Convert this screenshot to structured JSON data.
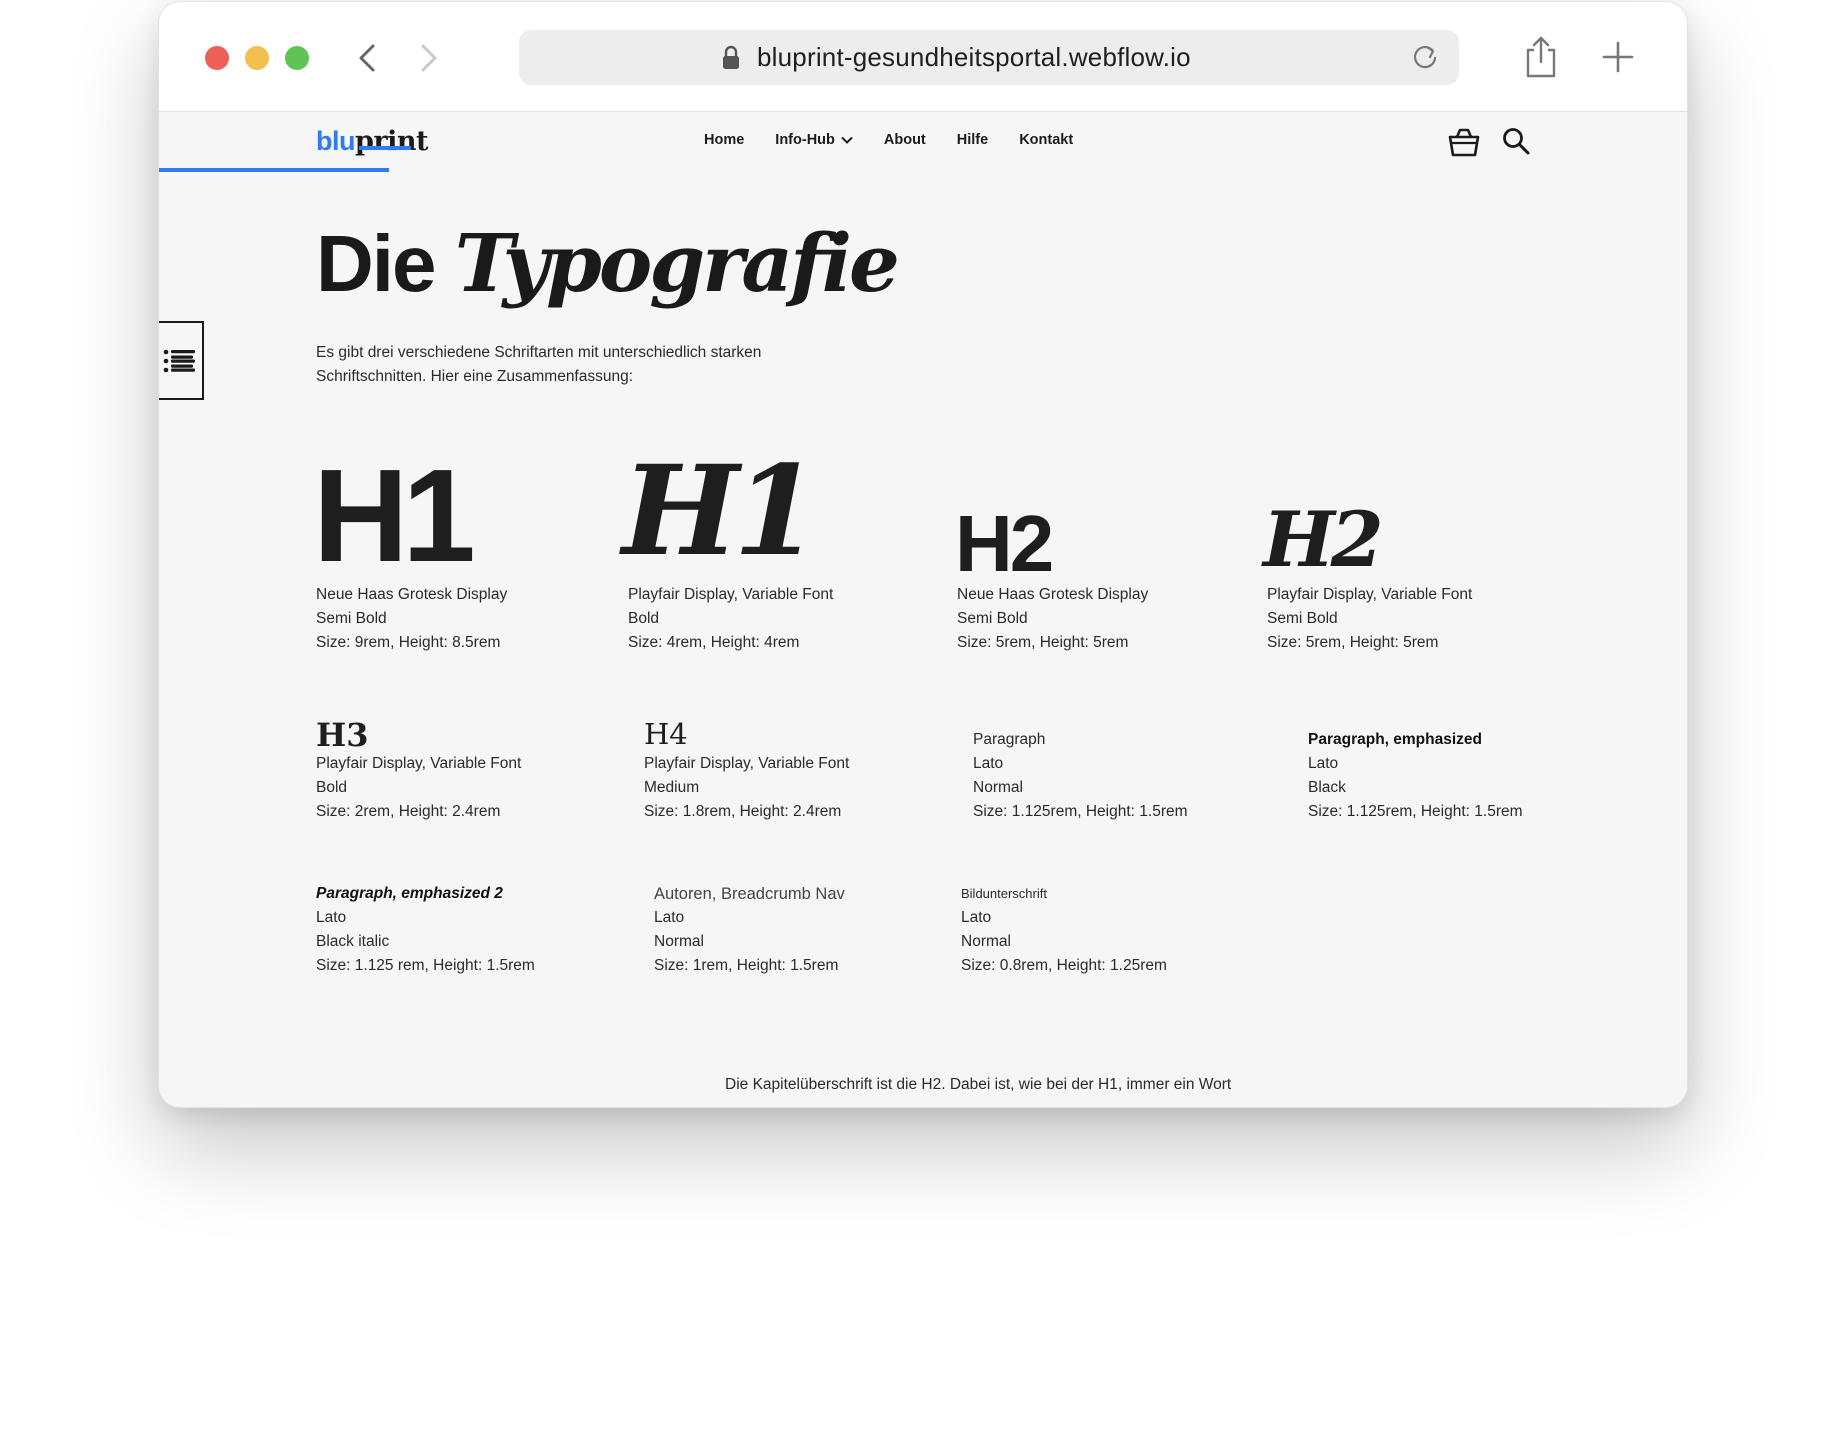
{
  "browser": {
    "url": "bluprint-gesundheitsportal.webflow.io",
    "traffic_lights": {
      "red": "#ed5f57",
      "yellow": "#f4bf4f",
      "green": "#5fc454"
    }
  },
  "site": {
    "logo": {
      "part1": "blu",
      "part2": "print",
      "accent": "#2f7cf0"
    },
    "nav": [
      "Home",
      "Info-Hub",
      "About",
      "Hilfe",
      "Kontakt"
    ]
  },
  "page": {
    "title_plain": "Die ",
    "title_italic": "Typografie",
    "intro": "Es gibt drei verschiedene Schriftarten mit unterschiedlich starken Schriftschnitten. Hier eine Zusammenfassung:"
  },
  "specimens": [
    {
      "sample": "H1",
      "lines": [
        "Neue Haas Grotesk Display",
        "Semi Bold",
        "Size: 9rem, Height: 8.5rem"
      ]
    },
    {
      "sample": "H1",
      "lines": [
        "Playfair Display, Variable Font",
        "Bold",
        "Size: 4rem, Height: 4rem"
      ]
    },
    {
      "sample": "H2",
      "lines": [
        "Neue Haas Grotesk Display",
        "Semi Bold",
        "Size: 5rem, Height: 5rem"
      ]
    },
    {
      "sample": "H2",
      "lines": [
        "Playfair Display, Variable Font",
        "Semi Bold",
        "Size: 5rem, Height: 5rem"
      ]
    },
    {
      "sample": "H3",
      "lines": [
        "Playfair Display, Variable Font",
        "Bold",
        "Size: 2rem, Height: 2.4rem"
      ]
    },
    {
      "sample": "H4",
      "lines": [
        "Playfair Display, Variable Font",
        "Medium",
        "Size: 1.8rem, Height: 2.4rem"
      ]
    },
    {
      "sample": "",
      "lines": [
        "Paragraph",
        "Lato",
        "Normal",
        "Size: 1.125rem, Height: 1.5rem"
      ]
    },
    {
      "sample": "",
      "lines": [
        "Paragraph, emphasized",
        "Lato",
        "Black",
        "Size: 1.125rem, Height: 1.5rem"
      ]
    },
    {
      "sample": "",
      "lines": [
        "Paragraph, emphasized 2",
        "Lato",
        "Black italic",
        "Size: 1.125 rem, Height: 1.5rem"
      ]
    },
    {
      "sample": "",
      "lines": [
        "Autoren, Breadcrumb Nav",
        "Lato",
        "Normal",
        "Size: 1rem, Height: 1.5rem"
      ]
    },
    {
      "sample": "",
      "lines": [
        "Bildunterschrift",
        "Lato",
        "Normal",
        "Size: 0.8rem, Height: 1.25rem"
      ]
    }
  ],
  "bottom_text": "Die Kapitelüberschrift ist die H2. Dabei ist, wie bei der H1, immer ein Wort"
}
